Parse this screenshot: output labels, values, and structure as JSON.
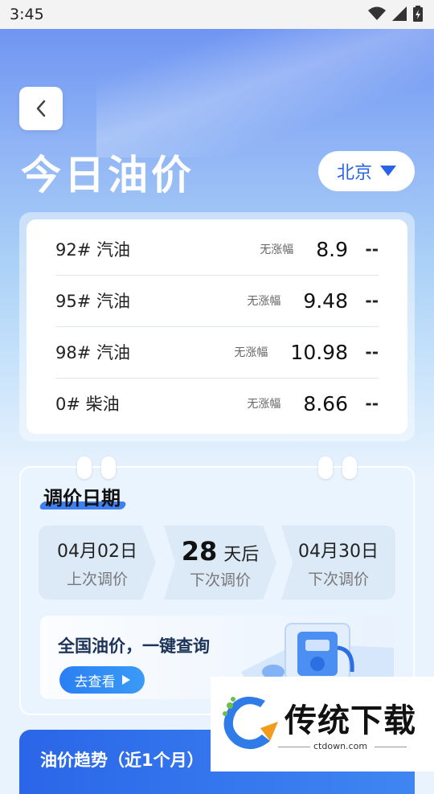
{
  "status_bar": {
    "time": "3:45"
  },
  "header": {
    "title": "今日油价",
    "city": "北京"
  },
  "prices": [
    {
      "name": "92# 汽油",
      "change": "无涨幅",
      "price": "8.9",
      "trend": "--"
    },
    {
      "name": "95# 汽油",
      "change": "无涨幅",
      "price": "9.48",
      "trend": "--"
    },
    {
      "name": "98# 汽油",
      "change": "无涨幅",
      "price": "10.98",
      "trend": "--"
    },
    {
      "name": "0# 柴油",
      "change": "无涨幅",
      "price": "8.66",
      "trend": "--"
    }
  ],
  "schedule": {
    "title": "调价日期",
    "last": {
      "date": "04月02日",
      "label": "上次调价"
    },
    "countdown": {
      "days": "28",
      "unit": "天后",
      "label": "下次调价"
    },
    "next": {
      "date": "04月30日",
      "label": "下次调价"
    }
  },
  "banner": {
    "title": "全国油价，一键查询",
    "button": "去查看"
  },
  "trend": {
    "title": "油价趋势（近1个月）"
  },
  "watermark": {
    "brand": "传统下载",
    "url": "ctdown.com"
  },
  "colors": {
    "accent": "#2a64e6",
    "hero_top": "#6f95f2",
    "card_bg": "#ffffff"
  },
  "icons": [
    "wifi-icon",
    "signal-icon",
    "battery-icon",
    "back-chevron-icon",
    "dropdown-triangle-icon",
    "play-triangle-icon",
    "fuel-pump-icon",
    "watermark-logo-icon"
  ]
}
